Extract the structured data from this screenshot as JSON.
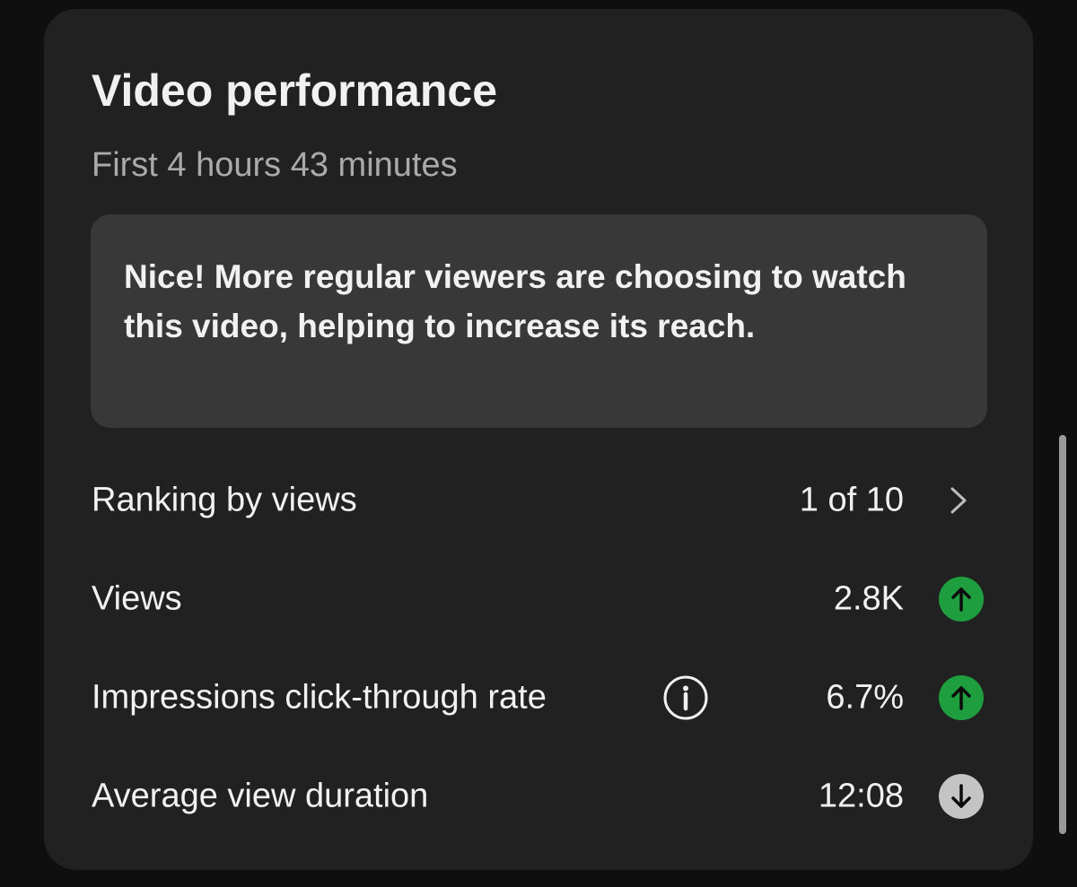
{
  "card": {
    "title": "Video performance",
    "subtitle": "First 4 hours 43 minutes",
    "insight": "Nice! More regular viewers are choosing to watch this video, helping to increase its reach."
  },
  "metrics": [
    {
      "label": "Ranking by views",
      "value": "1 of 10",
      "indicator": "chevron-right-icon"
    },
    {
      "label": "Views",
      "value": "2.8K",
      "indicator": "arrow-up-icon",
      "trend": "up"
    },
    {
      "label": "Impressions click-through rate",
      "value": "6.7%",
      "indicator": "arrow-up-icon",
      "trend": "up",
      "has_info": true
    },
    {
      "label": "Average view duration",
      "value": "12:08",
      "indicator": "arrow-down-icon",
      "trend": "down"
    }
  ],
  "colors": {
    "background": "#0f0f0f",
    "card": "#212121",
    "insight_box": "#383838",
    "trend_up": "#1e9e3e",
    "trend_down": "#c4c4c4",
    "secondary_text": "#aaaaaa"
  }
}
